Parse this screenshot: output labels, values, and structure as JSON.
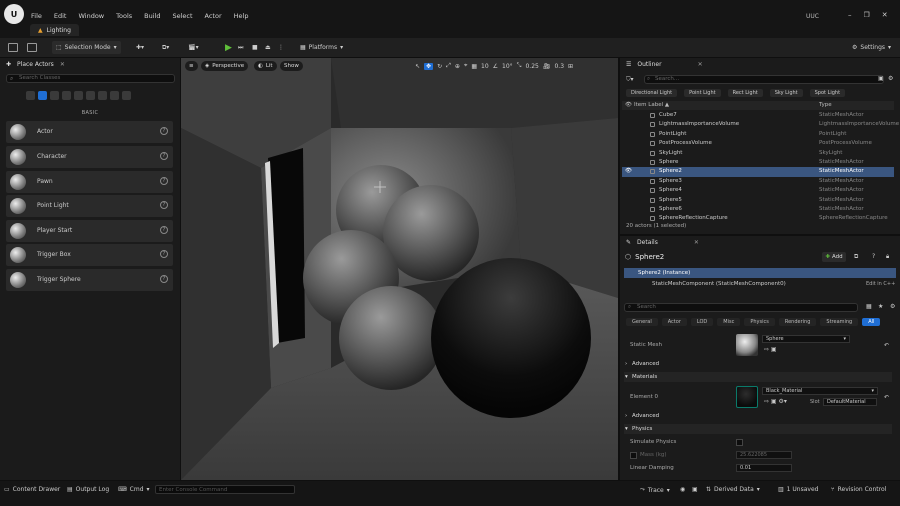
{
  "app": {
    "logo": "U",
    "document_tab": "Lighting",
    "project": "UUC"
  },
  "menu": [
    "File",
    "Edit",
    "Window",
    "Tools",
    "Build",
    "Select",
    "Actor",
    "Help"
  ],
  "toolbar": {
    "selection_mode": "Selection Mode",
    "platforms": "Platforms",
    "settings": "Settings"
  },
  "place_actors": {
    "tab": "Place Actors",
    "search_placeholder": "Search Classes",
    "category": "BASIC",
    "items": [
      "Actor",
      "Character",
      "Pawn",
      "Point Light",
      "Player Start",
      "Trigger Box",
      "Trigger Sphere"
    ]
  },
  "viewport": {
    "perspective": "Perspective",
    "lit": "Lit",
    "show": "Show",
    "grid": "10",
    "angle": "10°",
    "scale": "0.25",
    "camera_speed": "0.3"
  },
  "outliner": {
    "tab": "Outliner",
    "search_placeholder": "Search...",
    "filters": [
      "Directional Light",
      "Point Light",
      "Rect Light",
      "Sky Light",
      "Spot Light"
    ],
    "col_label": "Item Label ▲",
    "col_type": "Type",
    "rows": [
      {
        "name": "Cube7",
        "type": "StaticMeshActor"
      },
      {
        "name": "LightmassImportanceVolume",
        "type": "LightmassImportanceVolume"
      },
      {
        "name": "PointLight",
        "type": "PointLight"
      },
      {
        "name": "PostProcessVolume",
        "type": "PostProcessVolume"
      },
      {
        "name": "SkyLight",
        "type": "SkyLight"
      },
      {
        "name": "Sphere",
        "type": "StaticMeshActor"
      },
      {
        "name": "Sphere2",
        "type": "StaticMeshActor"
      },
      {
        "name": "Sphere3",
        "type": "StaticMeshActor"
      },
      {
        "name": "Sphere4",
        "type": "StaticMeshActor"
      },
      {
        "name": "Sphere5",
        "type": "StaticMeshActor"
      },
      {
        "name": "Sphere6",
        "type": "StaticMeshActor"
      },
      {
        "name": "SphereReflectionCapture",
        "type": "SphereReflectionCapture"
      }
    ],
    "selected_index": 6,
    "count": "20 actors (1 selected)"
  },
  "details": {
    "tab": "Details",
    "object": "Sphere2",
    "add_label": "Add",
    "instance": "Sphere2 (Instance)",
    "component": "StaticMeshComponent (StaticMeshComponent0)",
    "edit_cpp": "Edit in C++",
    "search_placeholder": "Search",
    "categories": [
      "General",
      "Actor",
      "LOD",
      "Misc",
      "Physics",
      "Rendering",
      "Streaming",
      "All"
    ],
    "selected_category": "All",
    "static_mesh_label": "Static Mesh",
    "static_mesh_value": "Sphere",
    "advanced_1": "Advanced",
    "materials_section": "Materials",
    "element_label": "Element 0",
    "material_value": "Black_Material",
    "slot_label": "Slot",
    "slot_value": "DefaultMaterial",
    "advanced_2": "Advanced",
    "physics_section": "Physics",
    "simulate_label": "Simulate Physics",
    "mass_label": "Mass (kg)",
    "mass_value": "25.622085",
    "linear_damping_label": "Linear Damping",
    "linear_damping_value": "0.01"
  },
  "bottombar": {
    "content_drawer": "Content Drawer",
    "output_log": "Output Log",
    "cmd": "Cmd",
    "cmd_placeholder": "Enter Console Command",
    "trace": "Trace",
    "derived_data": "Derived Data",
    "unsaved": "1 Unsaved",
    "revision_control": "Revision Control"
  },
  "colors": {
    "accent": "#1f6ed4",
    "selection": "#3a5680",
    "play": "#5fbf3a"
  }
}
